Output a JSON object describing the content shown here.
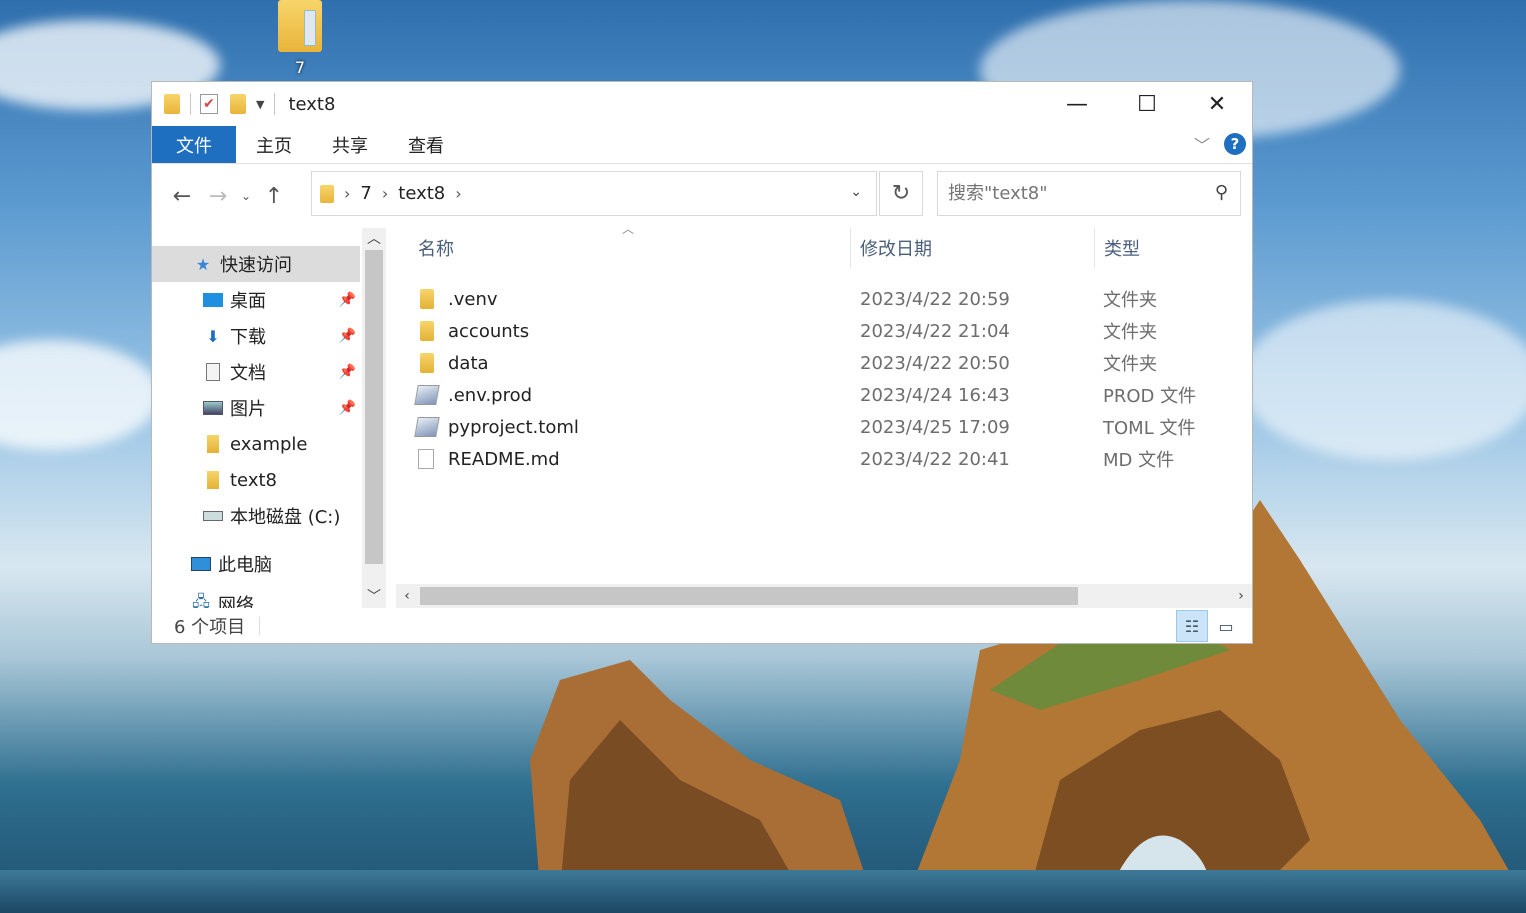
{
  "desktop": {
    "icon_label": "7"
  },
  "window": {
    "title": "text8",
    "controls": {
      "minimize": "—",
      "maximize": "☐",
      "close": "✕"
    }
  },
  "ribbon": {
    "tabs": [
      {
        "label": "文件",
        "active": true
      },
      {
        "label": "主页",
        "active": false
      },
      {
        "label": "共享",
        "active": false
      },
      {
        "label": "查看",
        "active": false
      }
    ]
  },
  "address": {
    "crumbs": [
      "7",
      "text8"
    ]
  },
  "search": {
    "placeholder": "搜索\"text8\""
  },
  "sidebar": {
    "quick_access": "快速访问",
    "items": [
      {
        "label": "桌面",
        "icon": "desktop-icon",
        "pinned": true
      },
      {
        "label": "下载",
        "icon": "download-icon",
        "pinned": true
      },
      {
        "label": "文档",
        "icon": "document-icon",
        "pinned": true
      },
      {
        "label": "图片",
        "icon": "pictures-icon",
        "pinned": true
      },
      {
        "label": "example",
        "icon": "folder-icon",
        "pinned": false
      },
      {
        "label": "text8",
        "icon": "folder-icon",
        "pinned": false
      },
      {
        "label": "本地磁盘 (C:)",
        "icon": "drive-icon",
        "pinned": false
      }
    ],
    "this_pc": "此电脑",
    "network": "网络"
  },
  "columns": {
    "name": "名称",
    "date": "修改日期",
    "type": "类型"
  },
  "files": [
    {
      "name": ".venv",
      "date": "2023/4/22 20:59",
      "type": "文件夹",
      "icon": "folder-icon"
    },
    {
      "name": "accounts",
      "date": "2023/4/22 21:04",
      "type": "文件夹",
      "icon": "folder-icon"
    },
    {
      "name": "data",
      "date": "2023/4/22 20:50",
      "type": "文件夹",
      "icon": "folder-icon"
    },
    {
      "name": ".env.prod",
      "date": "2023/4/24 16:43",
      "type": "PROD 文件",
      "icon": "file-icon"
    },
    {
      "name": "pyproject.toml",
      "date": "2023/4/25 17:09",
      "type": "TOML 文件",
      "icon": "file-icon"
    },
    {
      "name": "README.md",
      "date": "2023/4/22 20:41",
      "type": "MD 文件",
      "icon": "blank-file-icon"
    }
  ],
  "status": {
    "count": "6 个项目"
  }
}
